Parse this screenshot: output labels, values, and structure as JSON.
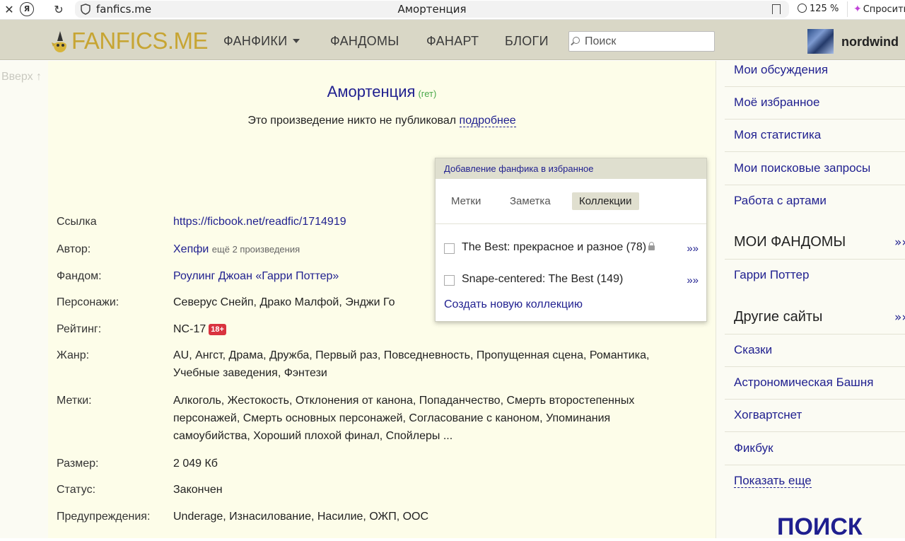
{
  "browser": {
    "url": "fanfics.me",
    "tab_title": "Амортенция",
    "zoom": "125 %",
    "ask_label": "Спросить"
  },
  "header": {
    "logo": "FANFICS.ME",
    "nav": [
      "ФАНФИКИ",
      "ФАНДОМЫ",
      "ФАНАРТ",
      "БЛОГИ"
    ],
    "search_placeholder": "Поиск",
    "username": "nordwind"
  },
  "up_link": "Вверх ↑",
  "work": {
    "title": "Амортенция",
    "orientation": "(гет)",
    "pub_text": "Это произведение никто не публиковал",
    "pub_more": "подробнее",
    "rows": [
      {
        "label": "Ссылка",
        "value": "https://ficbook.net/readfic/1714919"
      },
      {
        "label": "Автор:",
        "value": "Хепфи",
        "extra": "ещё 2 произведения"
      },
      {
        "label": "Фандом:",
        "value": "Роулинг Джоан «Гарри Поттер»"
      },
      {
        "label": "Персонажи:",
        "value": "Северус Снейп, Драко Малфой, Энджи Го"
      },
      {
        "label": "Рейтинг:",
        "value": "NC-17",
        "badge": "18+"
      },
      {
        "label": "Жанр:",
        "value": "AU, Ангст, Драма, Дружба, Первый раз, Повседневность, Пропущенная сцена, Романтика, Учебные заведения, Фэнтези"
      },
      {
        "label": "Метки:",
        "value": "Алкоголь, Жестокость, Отклонения от канона, Попаданчество, Смерть второстепенных персонажей, Смерть основных персонажей, Согласование с каноном, Упоминания самоубийства, Хороший плохой финал, Спойлеры ..."
      },
      {
        "label": "Размер:",
        "value": "2 049 Кб"
      },
      {
        "label": "Статус:",
        "value": "Закончен"
      },
      {
        "label": "Предупреждения:",
        "value": "Underage, Изнасилование, Насилие, ОЖП, ООС"
      }
    ]
  },
  "favorites_popup": {
    "header": "Добавление фанфика в избранное",
    "tabs": [
      "Метки",
      "Заметка",
      "Коллекции"
    ],
    "active_tab": "Коллекции",
    "collections": [
      {
        "name": "The Best: прекрасное и разное (78)",
        "locked": true,
        "arrow": "»»"
      },
      {
        "name": "Snape-centered: The Best (149)",
        "locked": false,
        "arrow": "»»"
      }
    ],
    "create_link": "Создать новую коллекцию"
  },
  "right_col": {
    "links": [
      "Мои обсуждения",
      "Моё избранное",
      "Моя статистика",
      "Мои поисковые запросы",
      "Работа с артами"
    ],
    "my_fandoms_title": "МОИ ФАНДОМЫ",
    "my_fandoms": [
      "Гарри Поттер"
    ],
    "other_sites_title": "Другие сайты",
    "other_sites": [
      "Сказки",
      "Астрономическая Башня",
      "Хогвартснет",
      "Фикбук"
    ],
    "show_more": "Показать еще",
    "more_arrow": "»»",
    "search_heading": "ПОИСК"
  }
}
